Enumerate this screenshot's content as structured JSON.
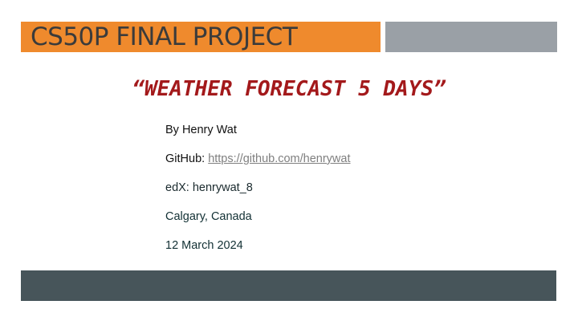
{
  "header": {
    "title": "CS50P FINAL PROJECT"
  },
  "subtitle": "“WEATHER FORECAST 5 DAYS”",
  "info": {
    "author": "By Henry Wat",
    "github_label": "GitHub: ",
    "github_url": "https://github.com/henrywat",
    "edx_label": "edX: ",
    "edx_value": "henrywat_8",
    "location": "Calgary, Canada",
    "date": "12 March 2024"
  },
  "colors": {
    "header_orange": "#ef8a2d",
    "header_gray": "#9aa0a6",
    "subtitle_red": "#a3191b",
    "footer_bar": "#47555a",
    "link_gray": "#7f7f7f"
  }
}
